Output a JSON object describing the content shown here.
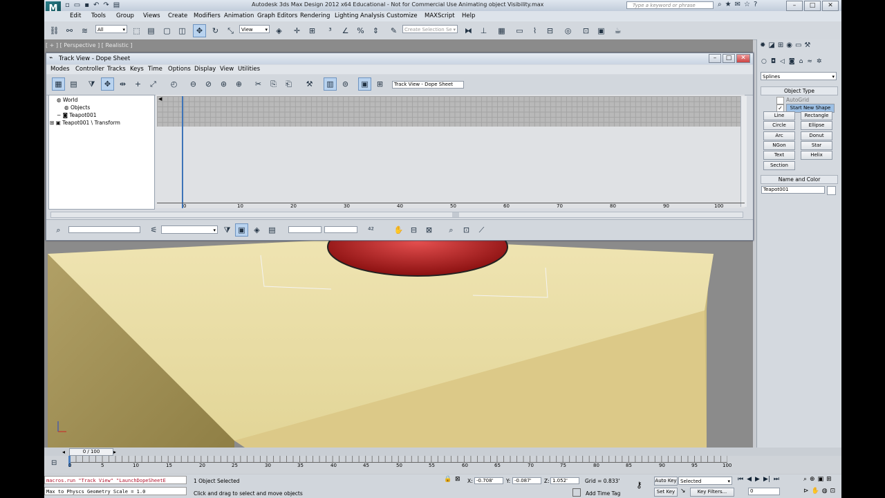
{
  "app": {
    "title": "Autodesk 3ds Max Design 2012 x64    Educational - Not for Commercial Use    Animating object Visibility.max",
    "search_placeholder": "Type a keyword or phrase"
  },
  "menu": [
    "Edit",
    "Tools",
    "Group",
    "Views",
    "Create",
    "Modifiers",
    "Animation",
    "Graph Editors",
    "Rendering",
    "Lighting Analysis",
    "Customize",
    "MAXScript",
    "Help"
  ],
  "toolbar": {
    "selection_filter": "All",
    "ref_coord": "View",
    "named_selection_placeholder": "Create Selection Se"
  },
  "viewport": {
    "label": "[ + ] [ Perspective ] [ Realistic ]"
  },
  "trackview": {
    "title": "Track View - Dope Sheet",
    "menu": [
      "Modes",
      "Controller",
      "Tracks",
      "Keys",
      "Time",
      "Options",
      "Display",
      "View",
      "Utilities"
    ],
    "name_field": "Track View - Dope Sheet",
    "tree": {
      "world": "World",
      "objects": "Objects",
      "teapot": "Teapot001",
      "transform": "Teapot001 \\ Transform"
    },
    "ruler_ticks": [
      "0",
      "10",
      "20",
      "30",
      "40",
      "50",
      "60",
      "70",
      "80",
      "90",
      "100"
    ]
  },
  "command_panel": {
    "category": "Splines",
    "object_type_header": "Object Type",
    "autogrid": "AutoGrid",
    "start_new_shape": "Start New Shape",
    "buttons": [
      "Line",
      "Rectangle",
      "Circle",
      "Ellipse",
      "Arc",
      "Donut",
      "NGon",
      "Star",
      "Text",
      "Helix",
      "Section"
    ],
    "name_color_header": "Name and Color",
    "name_value": "Teapot001"
  },
  "timeline": {
    "slider_label": "0 / 100",
    "ticks": [
      "0",
      "5",
      "10",
      "15",
      "20",
      "25",
      "30",
      "35",
      "40",
      "45",
      "50",
      "55",
      "60",
      "65",
      "70",
      "75",
      "80",
      "85",
      "90",
      "95",
      "100"
    ]
  },
  "status": {
    "macro_line1": "macros.run \"Track View\" \"LaunchDopeSheetE",
    "macro_line2": "Max to Physcs Geometry Scale = 1.0",
    "selected": "1 Object Selected",
    "prompt": "Click and drag to select and move objects",
    "x_label": "X:",
    "x_value": "-0.708'",
    "y_label": "Y:",
    "y_value": "-0.087'",
    "z_label": "Z:",
    "z_value": "1.052'",
    "grid": "Grid = 0.833'",
    "add_time_tag": "Add Time Tag",
    "auto_key": "Auto Key",
    "set_key": "Set Key",
    "selected_dd": "Selected",
    "key_filters": "Key Filters...",
    "frame": "0"
  }
}
